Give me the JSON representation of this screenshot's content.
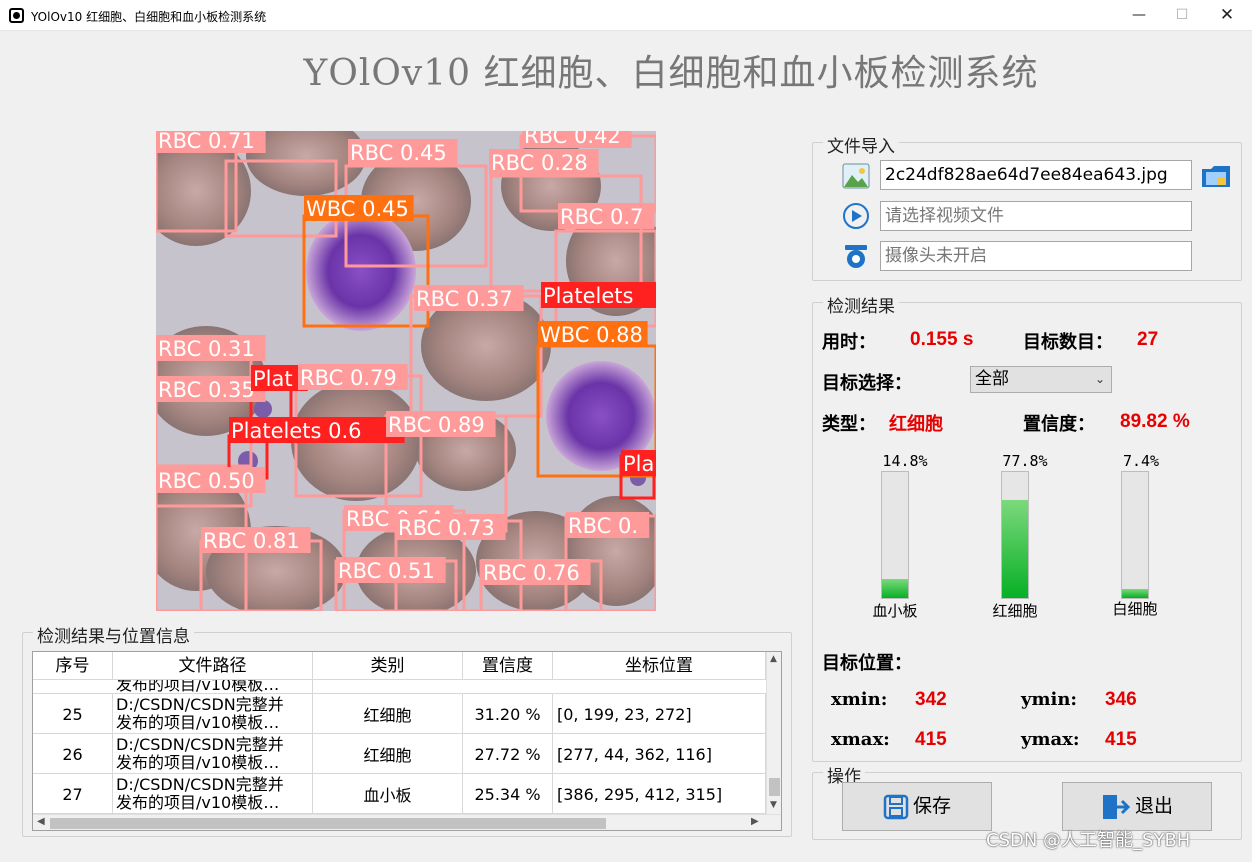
{
  "window": {
    "title": "YOlOv10 红细胞、白细胞和血小板检测系统",
    "minimize": "—",
    "maximize": "☐",
    "close": "✕"
  },
  "main_title": "YOlOv10 红细胞、白细胞和血小板检测系统",
  "detections": [
    {
      "label": "RBC 0.71",
      "color": "#ff9a9a"
    },
    {
      "label": "RBC 0.45",
      "color": "#ff9a9a"
    },
    {
      "label": "RBC 0.42",
      "color": "#ff9a9a"
    },
    {
      "label": "RBC 0.28",
      "color": "#ff9a9a"
    },
    {
      "label": "RBC 0.7",
      "color": "#ff9a9a"
    },
    {
      "label": "WBC 0.45",
      "color": "#ff7010"
    },
    {
      "label": "RBC 0.37",
      "color": "#ff9a9a"
    },
    {
      "label": "Platelets",
      "color": "#ff2020"
    },
    {
      "label": "WBC 0.88",
      "color": "#ff7010"
    },
    {
      "label": "RBC 0.31",
      "color": "#ff9a9a"
    },
    {
      "label": "RBC 0.35",
      "color": "#ff9a9a"
    },
    {
      "label": "Plat",
      "color": "#ff2020"
    },
    {
      "label": "RBC 0.79",
      "color": "#ff9a9a"
    },
    {
      "label": "Platelets 0.6",
      "color": "#ff2020"
    },
    {
      "label": "RBC 0.89",
      "color": "#ff9a9a"
    },
    {
      "label": "RBC 0.50",
      "color": "#ff9a9a"
    },
    {
      "label": "Pla",
      "color": "#ff2020"
    },
    {
      "label": "RBC 0.64",
      "color": "#ff9a9a"
    },
    {
      "label": "RBC 0.73",
      "color": "#ff9a9a"
    },
    {
      "label": "RBC 0.",
      "color": "#ff9a9a"
    },
    {
      "label": "RBC 0.81",
      "color": "#ff9a9a"
    },
    {
      "label": "RBC 0.51",
      "color": "#ff9a9a"
    },
    {
      "label": "RBC 0.76",
      "color": "#ff9a9a"
    }
  ],
  "file_import": {
    "title": "文件导入",
    "image_value": "2c24df828ae64d7ee84ea643.jpg",
    "video_placeholder": "请选择视频文件",
    "camera_placeholder": "摄像头未开启"
  },
  "results": {
    "title": "检测结果",
    "time_label": "用时：",
    "time_value": "0.155 s",
    "count_label": "目标数目：",
    "count_value": "27",
    "select_label": "目标选择：",
    "select_value": "全部",
    "type_label": "类型：",
    "type_value": "红细胞",
    "conf_label": "置信度：",
    "conf_value": "89.82 %",
    "bars": [
      {
        "name": "血小板",
        "percent_text": "14.8%",
        "fraction": 0.148
      },
      {
        "name": "红细胞",
        "percent_text": "77.8%",
        "fraction": 0.778
      },
      {
        "name": "白细胞",
        "percent_text": "7.4%",
        "fraction": 0.074
      }
    ],
    "position_label": "目标位置：",
    "xmin_label": "xmin:",
    "xmin_value": "342",
    "ymin_label": "ymin:",
    "ymin_value": "346",
    "xmax_label": "xmax:",
    "xmax_value": "415",
    "ymax_label": "ymax:",
    "ymax_value": "415"
  },
  "operations": {
    "title": "操作",
    "save": "保存",
    "exit": "退出"
  },
  "table": {
    "title": "检测结果与位置信息",
    "headers": [
      "序号",
      "文件路径",
      "类别",
      "置信度",
      "坐标位置"
    ],
    "partial_row": {
      "path": "发布的项目/v10模板…"
    },
    "rows": [
      {
        "id": "25",
        "path1": "D:/CSDN/CSDN完整并",
        "path2": "发布的项目/v10模板…",
        "cls": "红细胞",
        "conf": "31.20 %",
        "coords": "[0, 199, 23, 272]"
      },
      {
        "id": "26",
        "path1": "D:/CSDN/CSDN完整并",
        "path2": "发布的项目/v10模板…",
        "cls": "红细胞",
        "conf": "27.72 %",
        "coords": "[277, 44, 362, 116]"
      },
      {
        "id": "27",
        "path1": "D:/CSDN/CSDN完整并",
        "path2": "发布的项目/v10模板…",
        "cls": "血小板",
        "conf": "25.34 %",
        "coords": "[386, 295, 412, 315]"
      }
    ]
  },
  "watermark": "CSDN @人工智能_SYBH"
}
